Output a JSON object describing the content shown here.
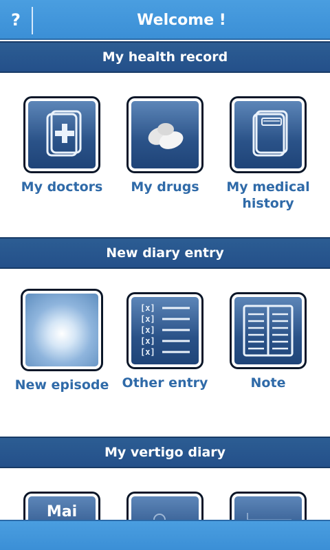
{
  "header": {
    "help_label": "?",
    "title": "Welcome !"
  },
  "sections": [
    {
      "title": "My health record",
      "items": [
        {
          "label": "My doctors",
          "icon": "doctor-book-icon"
        },
        {
          "label": "My drugs",
          "icon": "pills-icon"
        },
        {
          "label": "My medical history",
          "icon": "notebook-icon"
        }
      ]
    },
    {
      "title": "New diary entry",
      "items": [
        {
          "label": "New episode",
          "icon": "swirl-icon"
        },
        {
          "label": "Other entry",
          "icon": "checklist-icon"
        },
        {
          "label": "Note",
          "icon": "open-book-icon"
        }
      ]
    },
    {
      "title": "My vertigo diary",
      "items": [
        {
          "label": "",
          "icon": "calendar-icon",
          "icon_text": "Mai"
        },
        {
          "label": "",
          "icon": "search-icon"
        },
        {
          "label": "",
          "icon": "chart-icon"
        }
      ]
    }
  ],
  "colors": {
    "topbar": "#3b8fd6",
    "section_header": "#24508a",
    "label": "#2f6aa8",
    "icon_bg": "#2a5288"
  }
}
